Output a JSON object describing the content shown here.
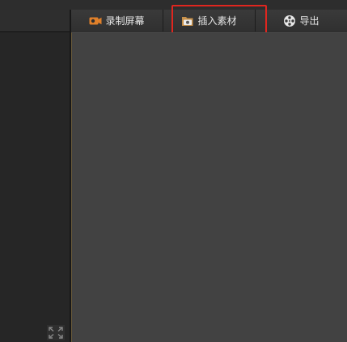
{
  "toolbar": {
    "tabs": [
      {
        "label": "录制屏幕",
        "icon": "record-camera-icon"
      },
      {
        "label": "插入素材",
        "icon": "insert-media-icon"
      },
      {
        "label": "导出",
        "icon": "film-reel-icon"
      }
    ]
  },
  "colors": {
    "accent_record": "#e0802a",
    "highlight_box": "#e0261f",
    "canvas_bg": "#424242",
    "panel_bg": "#262626"
  },
  "left_panel": {
    "fullscreen_icon": "fullscreen-icon"
  }
}
